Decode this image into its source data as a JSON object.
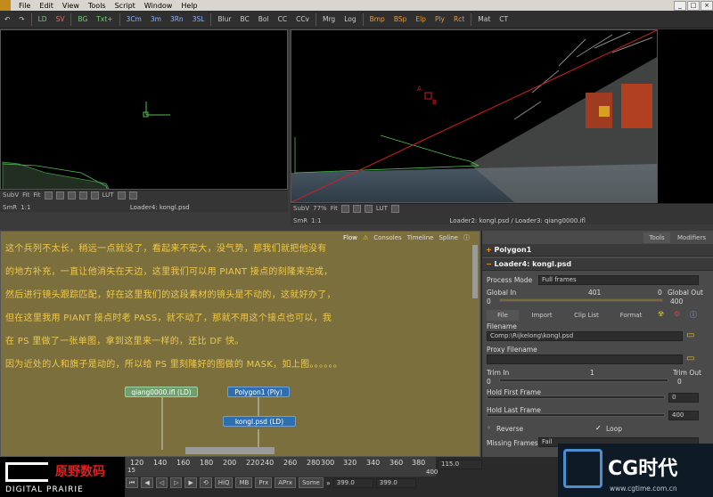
{
  "menu": {
    "items": [
      "File",
      "Edit",
      "View",
      "Tools",
      "Script",
      "Window",
      "Help"
    ]
  },
  "toolbar": {
    "buttons": [
      "LD",
      "SV",
      "BG",
      "Txt+",
      "3Cm",
      "3m",
      "3Rn",
      "3SL",
      "Blur",
      "BC",
      "Bol",
      "CC",
      "CCv",
      "Mrg",
      "Log",
      "Bmp",
      "BSp",
      "Elp",
      "Ply",
      "Rct",
      "Mat",
      "CT"
    ]
  },
  "viewer_left": {
    "label": "Loader4: kongl.psd",
    "subv": "SubV",
    "fit": "Fit",
    "fit2": "Fit",
    "smr": "SmR",
    "ratio": "1:1",
    "lut": "LUT"
  },
  "viewer_right": {
    "label": "Loader2: kongl.psd / Loader3: qiang0000.ifl",
    "subv": "SubV",
    "zoom": "77%",
    "fit": "Fit",
    "smr": "SmR",
    "ratio": "1:1",
    "lut": "LUT",
    "point_a": "A",
    "point_b": "B"
  },
  "flow_tabs": [
    "Flow",
    "Consoles",
    "Timeline",
    "Spline"
  ],
  "notes": [
    "这个兵列不太长，稍远一点就没了，看起来不宏大，没气势，那我们就把他没有",
    "的地方补充，一直让他消失在天边，这里我们可以用 PIANT 接点的刻隆来完成，",
    "然后进行镜头跟踪匹配，好在这里我们的这段素材的镜头是不动的，这就好办了，",
    "但在这里我用 PIANT 接点时老 PASS，就不动了，那就不用这个接点也可以，我",
    "在 PS 里做了一张单图，拿到这里来一样的，还比 DF 快。",
    "因为近处的人和旗子是动的，所以给 PS 里刻隆好的图做的 MASK，如上图。。。。。。"
  ],
  "nodes": {
    "qiang": "qiang0000.ifl (LD)",
    "polygon": "Polygon1 (Ply)",
    "kongl": "kongl.psd (LD)"
  },
  "panel": {
    "tabs": [
      "Tools",
      "Modifiers"
    ],
    "polygon_header": "Polygon1",
    "loader_header": "Loader4: kongl.psd",
    "process_mode_label": "Process Mode",
    "process_mode_value": "Full frames",
    "global_in_label": "Global In",
    "global_out_label": "Global Out",
    "global_in_value": "0",
    "global_mid": "401",
    "global_right": "0",
    "global_out_value": "400",
    "subtabs": [
      "File",
      "Import",
      "Clip List",
      "Format"
    ],
    "filename_label": "Filename",
    "filename_value": "Comp:\\Rijkelong\\kongl.psd",
    "proxy_label": "Proxy Filename",
    "trim_in_label": "Trim In",
    "trim_out_label": "Trim Out",
    "trim_in_value": "0",
    "trim_mid": "1",
    "trim_out_value": "0",
    "hold_first_label": "Hold First Frame",
    "hold_first_value": "0",
    "hold_last_label": "Hold Last Frame",
    "hold_last_value": "400",
    "reverse_label": "Reverse",
    "loop_label": "Loop",
    "missing_label": "Missing Frames",
    "missing_value": "Fail"
  },
  "timeline": {
    "ticks": [
      "120",
      "140",
      "160",
      "180",
      "200",
      "220",
      "240",
      "260",
      "280",
      "300",
      "320",
      "340",
      "360",
      "380",
      "400"
    ],
    "start_marker": "15",
    "current_field": "115.0",
    "transport": [
      "HiQ",
      "MB",
      "Prx",
      "APrx",
      "Some"
    ],
    "end_a": "399.0",
    "end_b": "399.0"
  },
  "brand": {
    "left_cn": "原野数码",
    "left_en": "DIGITAL PRAIRIE",
    "right_logo": "CG时代",
    "right_url": "www.cgtime.com.cn"
  },
  "colors": {
    "accent_gold": "#f0c94a",
    "node_green": "#6f9f6f",
    "node_blue": "#2f6fb0",
    "panel_orange": "#e69a3a"
  }
}
